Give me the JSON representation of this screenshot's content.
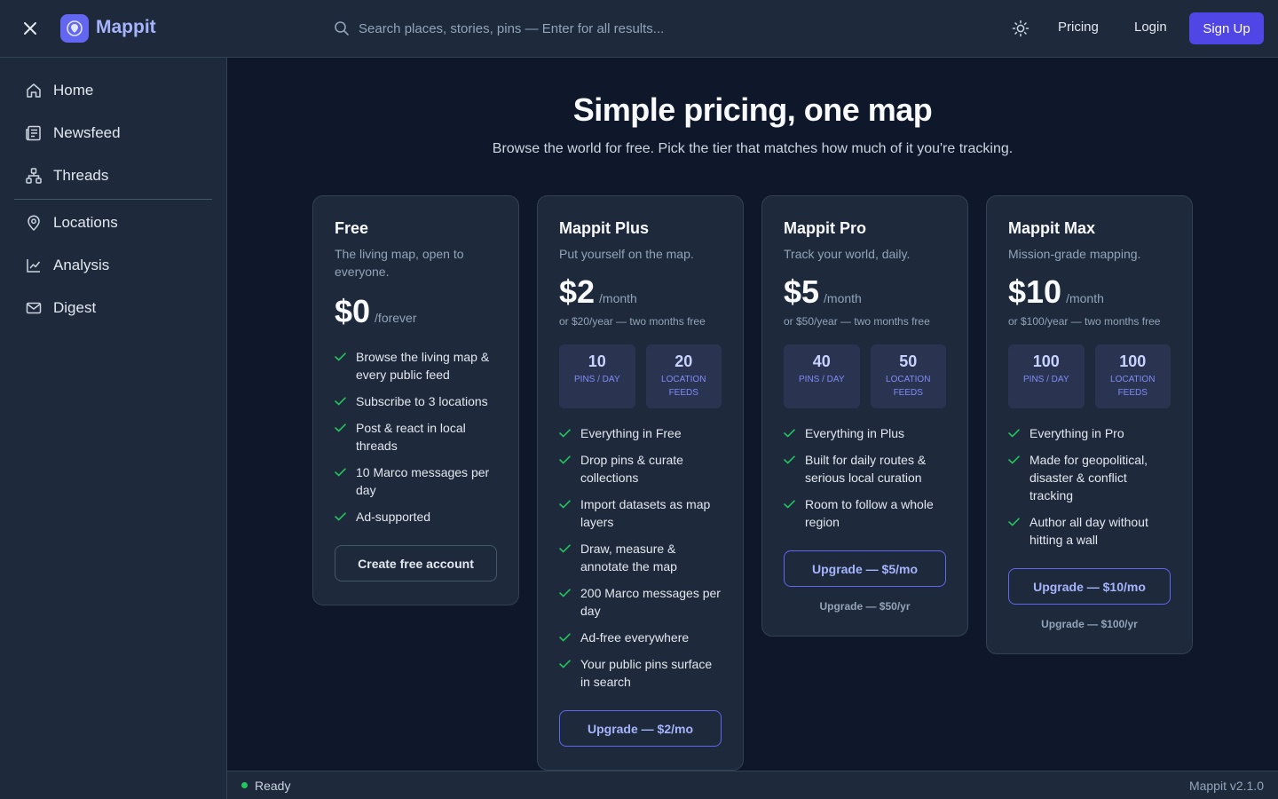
{
  "app": {
    "brand": "Mappit"
  },
  "colors": {
    "accent": "#4f46e5",
    "accent_light": "#a5b4fc",
    "success": "#22c55e",
    "bg": "#0f172a",
    "panel": "#1e293b"
  },
  "header": {
    "search_placeholder": "Search places, stories, pins — Enter for all results...",
    "pricing": "Pricing",
    "login": "Login",
    "signup": "Sign Up"
  },
  "sidebar": {
    "items": [
      {
        "label": "Home",
        "icon": "home-icon"
      },
      {
        "label": "Newsfeed",
        "icon": "newspaper-icon"
      },
      {
        "label": "Threads",
        "icon": "network-icon"
      },
      {
        "label": "Locations",
        "icon": "map-pin-icon"
      },
      {
        "label": "Analysis",
        "icon": "line-chart-icon"
      },
      {
        "label": "Digest",
        "icon": "mail-icon"
      }
    ]
  },
  "page": {
    "title": "Simple pricing, one map",
    "subtitle": "Browse the world for free. Pick the tier that matches how much of it you're tracking."
  },
  "plans": [
    {
      "name": "Free",
      "desc": "The living map, open to everyone.",
      "price": "$0",
      "period": "/forever",
      "features": [
        "Browse the living map & every public feed",
        "Subscribe to 3 locations",
        "Post & react in local threads",
        "10 Marco messages per day",
        "Ad-supported"
      ],
      "cta": "Create free account"
    },
    {
      "name": "Mappit Plus",
      "desc": "Put yourself on the map.",
      "price": "$2",
      "period": "/month",
      "yearly": "or $20/year — two months free",
      "quota_pins": "10",
      "quota_pins_label": "PINS / DAY",
      "quota_feeds": "20",
      "quota_feeds_label": "LOCATION FEEDS",
      "features": [
        "Everything in Free",
        "Drop pins & curate collections",
        "Import datasets as map layers",
        "Draw, measure & annotate the map",
        "200 Marco messages per day",
        "Ad-free everywhere",
        "Your public pins surface in search"
      ],
      "cta": "Upgrade — $2/mo"
    },
    {
      "name": "Mappit Pro",
      "desc": "Track your world, daily.",
      "price": "$5",
      "period": "/month",
      "yearly": "or $50/year — two months free",
      "quota_pins": "40",
      "quota_pins_label": "PINS / DAY",
      "quota_feeds": "50",
      "quota_feeds_label": "LOCATION FEEDS",
      "features": [
        "Everything in Plus",
        "Built for daily routes & serious local curation",
        "Room to follow a whole region"
      ],
      "cta": "Upgrade — $5/mo",
      "alt": "Upgrade — $50/yr"
    },
    {
      "name": "Mappit Max",
      "desc": "Mission-grade mapping.",
      "price": "$10",
      "period": "/month",
      "yearly": "or $100/year — two months free",
      "quota_pins": "100",
      "quota_pins_label": "PINS / DAY",
      "quota_feeds": "100",
      "quota_feeds_label": "LOCATION FEEDS",
      "features": [
        "Everything in Pro",
        "Made for geopolitical, disaster & conflict tracking",
        "Author all day without hitting a wall"
      ],
      "cta": "Upgrade — $10/mo",
      "alt": "Upgrade — $100/yr"
    }
  ],
  "status": {
    "text": "Ready",
    "version": "Mappit v2.1.0"
  }
}
